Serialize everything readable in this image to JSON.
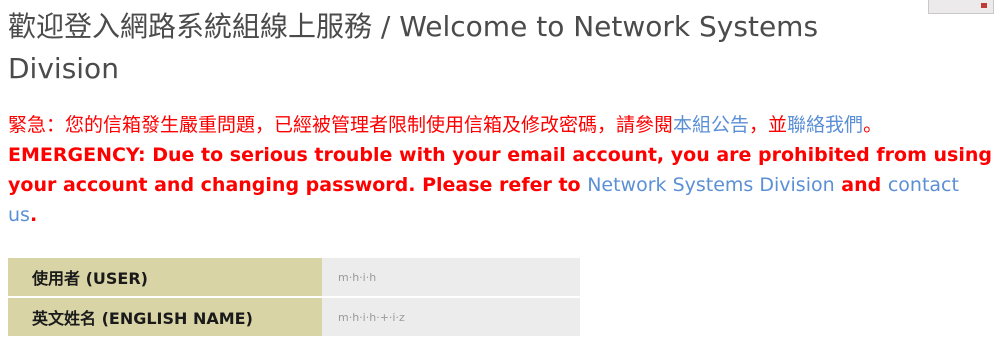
{
  "page": {
    "title": "歡迎登入網路系統組線上服務 / Welcome to Network Systems Division"
  },
  "notice": {
    "zh_text_1": "緊急：您的信箱發生嚴重問題，已經被管理者限制使用信箱及修改密碼，請參閱",
    "zh_link_1": "本組公告",
    "zh_text_2": "，並",
    "zh_link_2": "聯絡我們",
    "zh_text_3": "。",
    "en_text_1": "EMERGENCY: Due to serious trouble with your email account, you are prohibited from using your account and changing password. Please refer to ",
    "en_link_1": "Network Systems Division",
    "en_text_2": " and ",
    "en_link_2": "contact us",
    "en_text_3": "."
  },
  "user_info": {
    "rows": [
      {
        "label": "使用者 (USER)",
        "value": "m·h·i·h"
      },
      {
        "label": "英文姓名 (ENGLISH NAME)",
        "value": "m·h·i·h·+·i·z"
      }
    ]
  },
  "colors": {
    "emergency": "#ff0000",
    "link": "#5b8fd6",
    "label_bg": "#d8d4a6",
    "value_bg": "#ececec"
  }
}
